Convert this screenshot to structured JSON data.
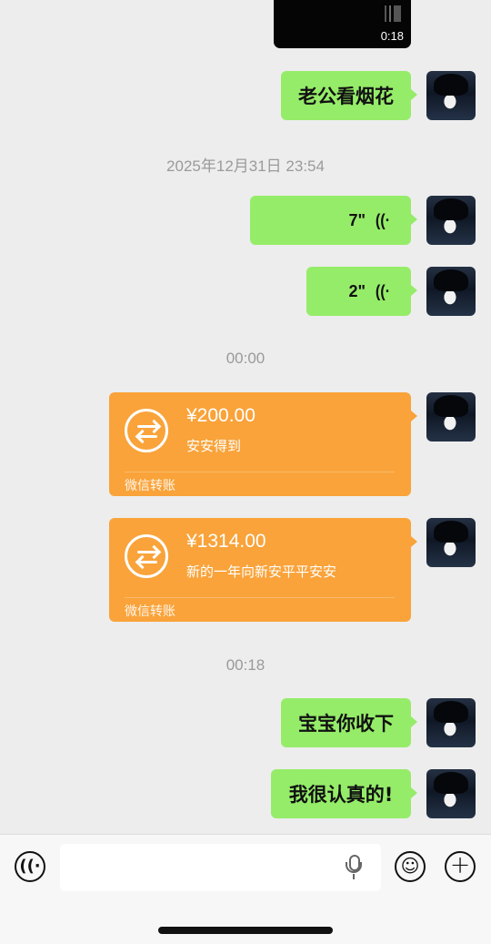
{
  "video": {
    "duration": "0:18"
  },
  "messages": {
    "text1": "老公看烟花",
    "voice1_duration": "7\"",
    "voice2_duration": "2\"",
    "text2": "宝宝你收下",
    "text3": "我很认真的!"
  },
  "timestamps": {
    "first": "2025年12月31日 23:54",
    "second": "00:00",
    "third": "00:18"
  },
  "voice_icon": "((·",
  "transfers": [
    {
      "amount": "¥200.00",
      "memo": "安安得到",
      "label": "微信转账"
    },
    {
      "amount": "¥1314.00",
      "memo": "新的一年向新安平平安安",
      "label": "微信转账"
    }
  ],
  "input_bar": {
    "voice_button_icon": "((·",
    "emoji_button_icon": "☺",
    "plus_button_icon": "+"
  },
  "colors": {
    "chat_background": "#ededed",
    "sent_bubble": "#95ec69",
    "transfer_card": "#f9a33a"
  }
}
